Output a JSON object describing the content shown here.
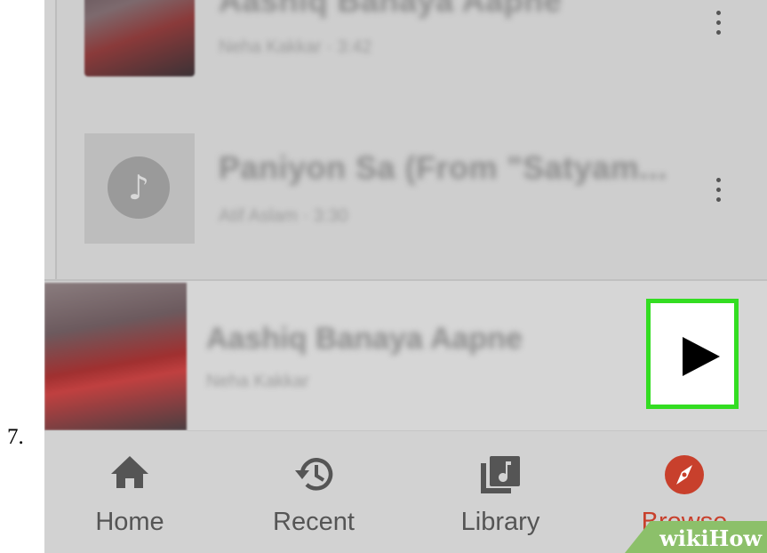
{
  "step": {
    "number": "7."
  },
  "songs": [
    {
      "title": "Aashiq Banaya Aapne",
      "subtitle": "Neha Kakkar · 3:42"
    },
    {
      "title": "Paniyon Sa (From \"Satyam...",
      "subtitle": "Atif Aslam · 3:30"
    }
  ],
  "mini_player": {
    "title": "Aashiq Banaya Aapne",
    "artist": "Neha Kakkar"
  },
  "bottom_nav": {
    "items": [
      {
        "label": "Home",
        "icon": "home-icon"
      },
      {
        "label": "Recent",
        "icon": "history-icon"
      },
      {
        "label": "Library",
        "icon": "library-icon"
      },
      {
        "label": "Browse",
        "icon": "compass-icon",
        "active": true
      }
    ]
  },
  "watermark": {
    "text": "wikiHow"
  },
  "colors": {
    "highlight_border": "#33dd22",
    "active_nav": "#c8402c",
    "watermark_bg": "#8cc06a"
  }
}
